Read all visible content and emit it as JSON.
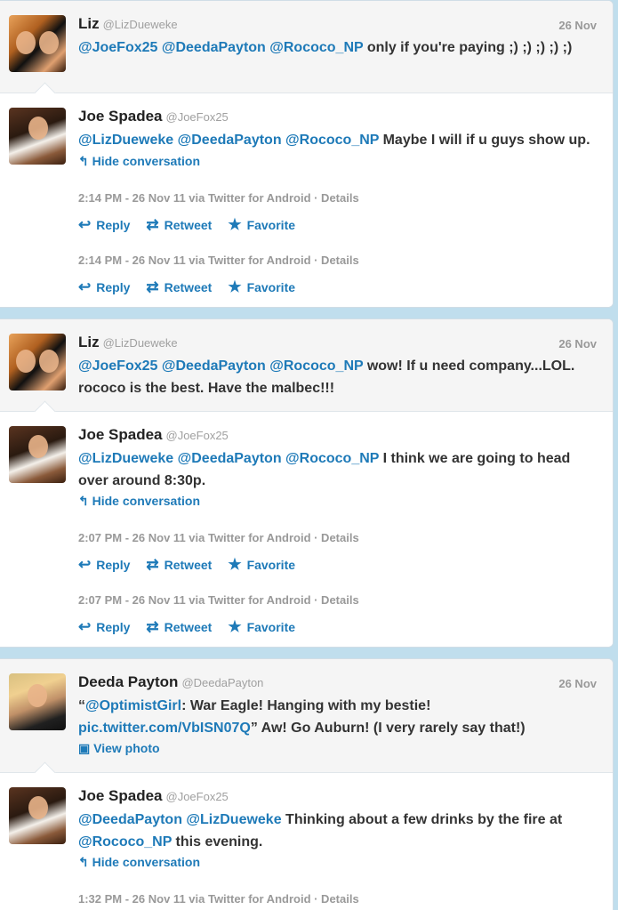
{
  "groups": [
    {
      "orig": {
        "name": "Liz",
        "handle": "@LizDueweke",
        "date": "26 Nov",
        "mentions": "@JoeFox25 @DeedaPayton @Rococo_NP",
        "text": " only if you're paying ;) ;) ;) ;) ;)"
      },
      "reply": {
        "name": "Joe Spadea",
        "handle": "@JoeFox25",
        "mentions": "@LizDueweke @DeedaPayton @Rococo_NP",
        "text": " Maybe I will if u guys show up.",
        "hide": "Hide conversation",
        "meta1": "2:14 PM - 26 Nov 11 via Twitter for Android · Details",
        "meta2": "2:14 PM - 26 Nov 11 via Twitter for Android · Details"
      }
    },
    {
      "orig": {
        "name": "Liz",
        "handle": "@LizDueweke",
        "date": "26 Nov",
        "mentions": "@JoeFox25 @DeedaPayton @Rococo_NP",
        "text": " wow! If u need company...LOL.",
        "text2": "rococo is the best. Have the malbec!!!"
      },
      "reply": {
        "name": "Joe Spadea",
        "handle": "@JoeFox25",
        "mentions": "@LizDueweke @DeedaPayton @Rococo_NP",
        "text": " I think we are going to head",
        "text2": "over around 8:30p.",
        "hide": "Hide conversation",
        "meta1": "2:07 PM - 26 Nov 11 via Twitter for Android · Details",
        "meta2": "2:07 PM - 26 Nov 11 via Twitter for Android · Details"
      }
    },
    {
      "orig": {
        "name": "Deeda Payton",
        "handle": "@DeedaPayton",
        "date": "26 Nov",
        "quote_open": "“",
        "q_mention": "@OptimistGirl",
        "text": ": War Eagle! Hanging with my bestie!",
        "q_link": "pic.twitter.com/VbISN07Q",
        "text2": "” Aw! Go Auburn! (I very rarely say that!)",
        "view_photo": "View photo"
      },
      "reply": {
        "name": "Joe Spadea",
        "handle": "@JoeFox25",
        "mentions": "@DeedaPayton @LizDueweke",
        "text": " Thinking about a few drinks by the fire at",
        "mention2": "@Rococo_NP",
        "text2": " this evening.",
        "hide": "Hide conversation",
        "meta1": "1:32 PM - 26 Nov 11 via Twitter for Android · Details"
      }
    }
  ],
  "actions": {
    "reply": "Reply",
    "retweet": "Retweet",
    "favorite": "Favorite"
  },
  "icons": {
    "reply": "reply-arrow-icon",
    "retweet": "retweet-icon",
    "favorite": "star-icon",
    "hide": "hide-arrow-icon",
    "photo": "photo-icon"
  },
  "colors": {
    "link": "#1e7ab8",
    "background": "#c0deed"
  }
}
